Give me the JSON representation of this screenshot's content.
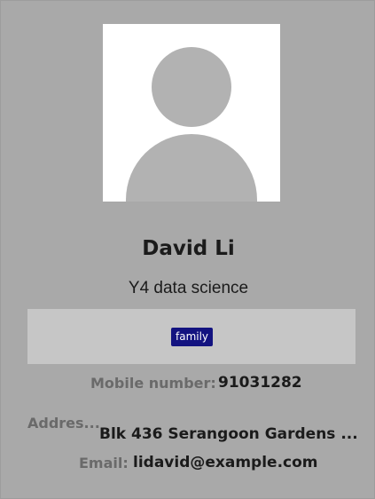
{
  "person": {
    "name": "David Li",
    "subtitle": "Y4 data science",
    "tags": [
      "family"
    ]
  },
  "fields": {
    "mobile_label": "Mobile number:",
    "mobile_value": "91031282",
    "address_label": "Addres...",
    "address_value": "Blk 436 Serangoon Gardens ...",
    "email_label": "Email:",
    "email_value": "lidavid@example.com"
  },
  "icons": {
    "avatar": "user-placeholder-icon"
  },
  "colors": {
    "background": "#a9a9a9",
    "tag_background": "#131380",
    "tags_panel": "#c6c6c6"
  }
}
